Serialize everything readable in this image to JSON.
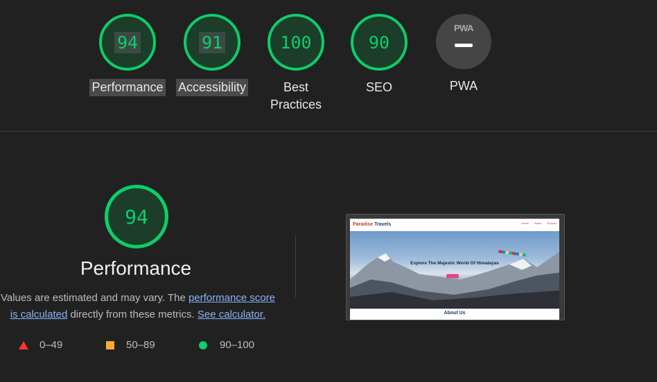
{
  "categories": [
    {
      "score": "94",
      "label": "Performance"
    },
    {
      "score": "91",
      "label": "Accessibility"
    },
    {
      "score": "100",
      "label": "Best Practices"
    },
    {
      "score": "90",
      "label": "SEO"
    },
    {
      "label": "PWA",
      "logo_text": "PWA"
    }
  ],
  "performance": {
    "score": "94",
    "title": "Performance",
    "desc_part1": "Values are estimated and may vary. The ",
    "link_score": "performance score is calculated",
    "desc_part2": " directly from these metrics. ",
    "link_calc": "See calculator."
  },
  "legend": {
    "fail": "0–49",
    "average": "50–89",
    "pass": "90–100"
  },
  "screenshot": {
    "brand_red": "Paradise",
    "brand_blue": " Travels",
    "nav": [
      "Home",
      "About",
      "Enquiry"
    ],
    "hero_text": "Explore The Majestic World Of Himalayas",
    "section": "About Us"
  },
  "colors": {
    "pass": "#0cce6b",
    "average": "#ffaa33",
    "fail": "#ff3333",
    "background": "#212121",
    "link": "#8ab4f8"
  }
}
